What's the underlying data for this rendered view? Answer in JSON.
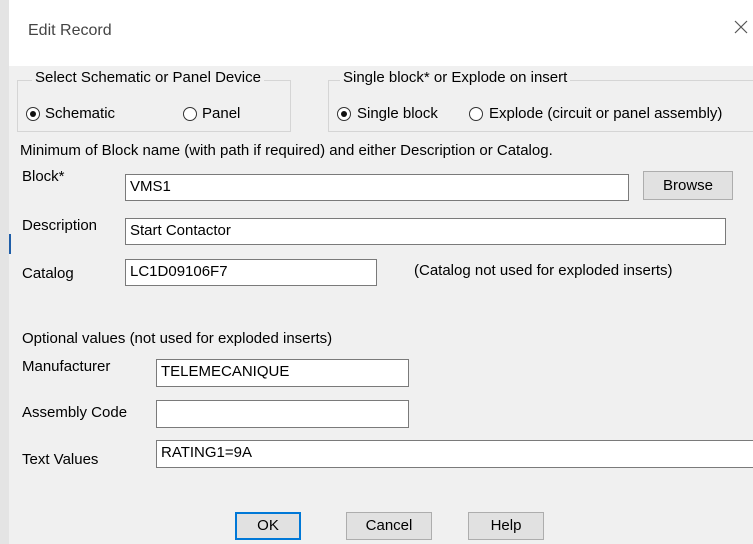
{
  "window": {
    "title": "Edit Record"
  },
  "device_group": {
    "legend": "Select Schematic or Panel Device",
    "options": [
      {
        "label": "Schematic",
        "selected": true
      },
      {
        "label": "Panel",
        "selected": false
      }
    ]
  },
  "insert_group": {
    "legend": "Single block* or Explode on insert",
    "options": [
      {
        "label": "Single block",
        "selected": true
      },
      {
        "label": "Explode (circuit or panel assembly)",
        "selected": false
      }
    ]
  },
  "instructions": "Minimum of Block name (with path if required) and either Description or Catalog.",
  "fields": {
    "block": {
      "label": "Block*",
      "value": "VMS1"
    },
    "description": {
      "label": "Description",
      "value": "Start Contactor"
    },
    "catalog": {
      "label": "Catalog",
      "value": "LC1D09106F7",
      "note": "(Catalog not used for exploded inserts)"
    }
  },
  "browse_label": "Browse",
  "optional": {
    "heading": "Optional values (not used for exploded inserts)",
    "manufacturer": {
      "label": "Manufacturer",
      "value": "TELEMECANIQUE"
    },
    "assembly_code": {
      "label": "Assembly Code",
      "value": ""
    },
    "text_values": {
      "label": "Text Values",
      "value": "RATING1=9A"
    }
  },
  "buttons": {
    "ok": "OK",
    "cancel": "Cancel",
    "help": "Help"
  }
}
